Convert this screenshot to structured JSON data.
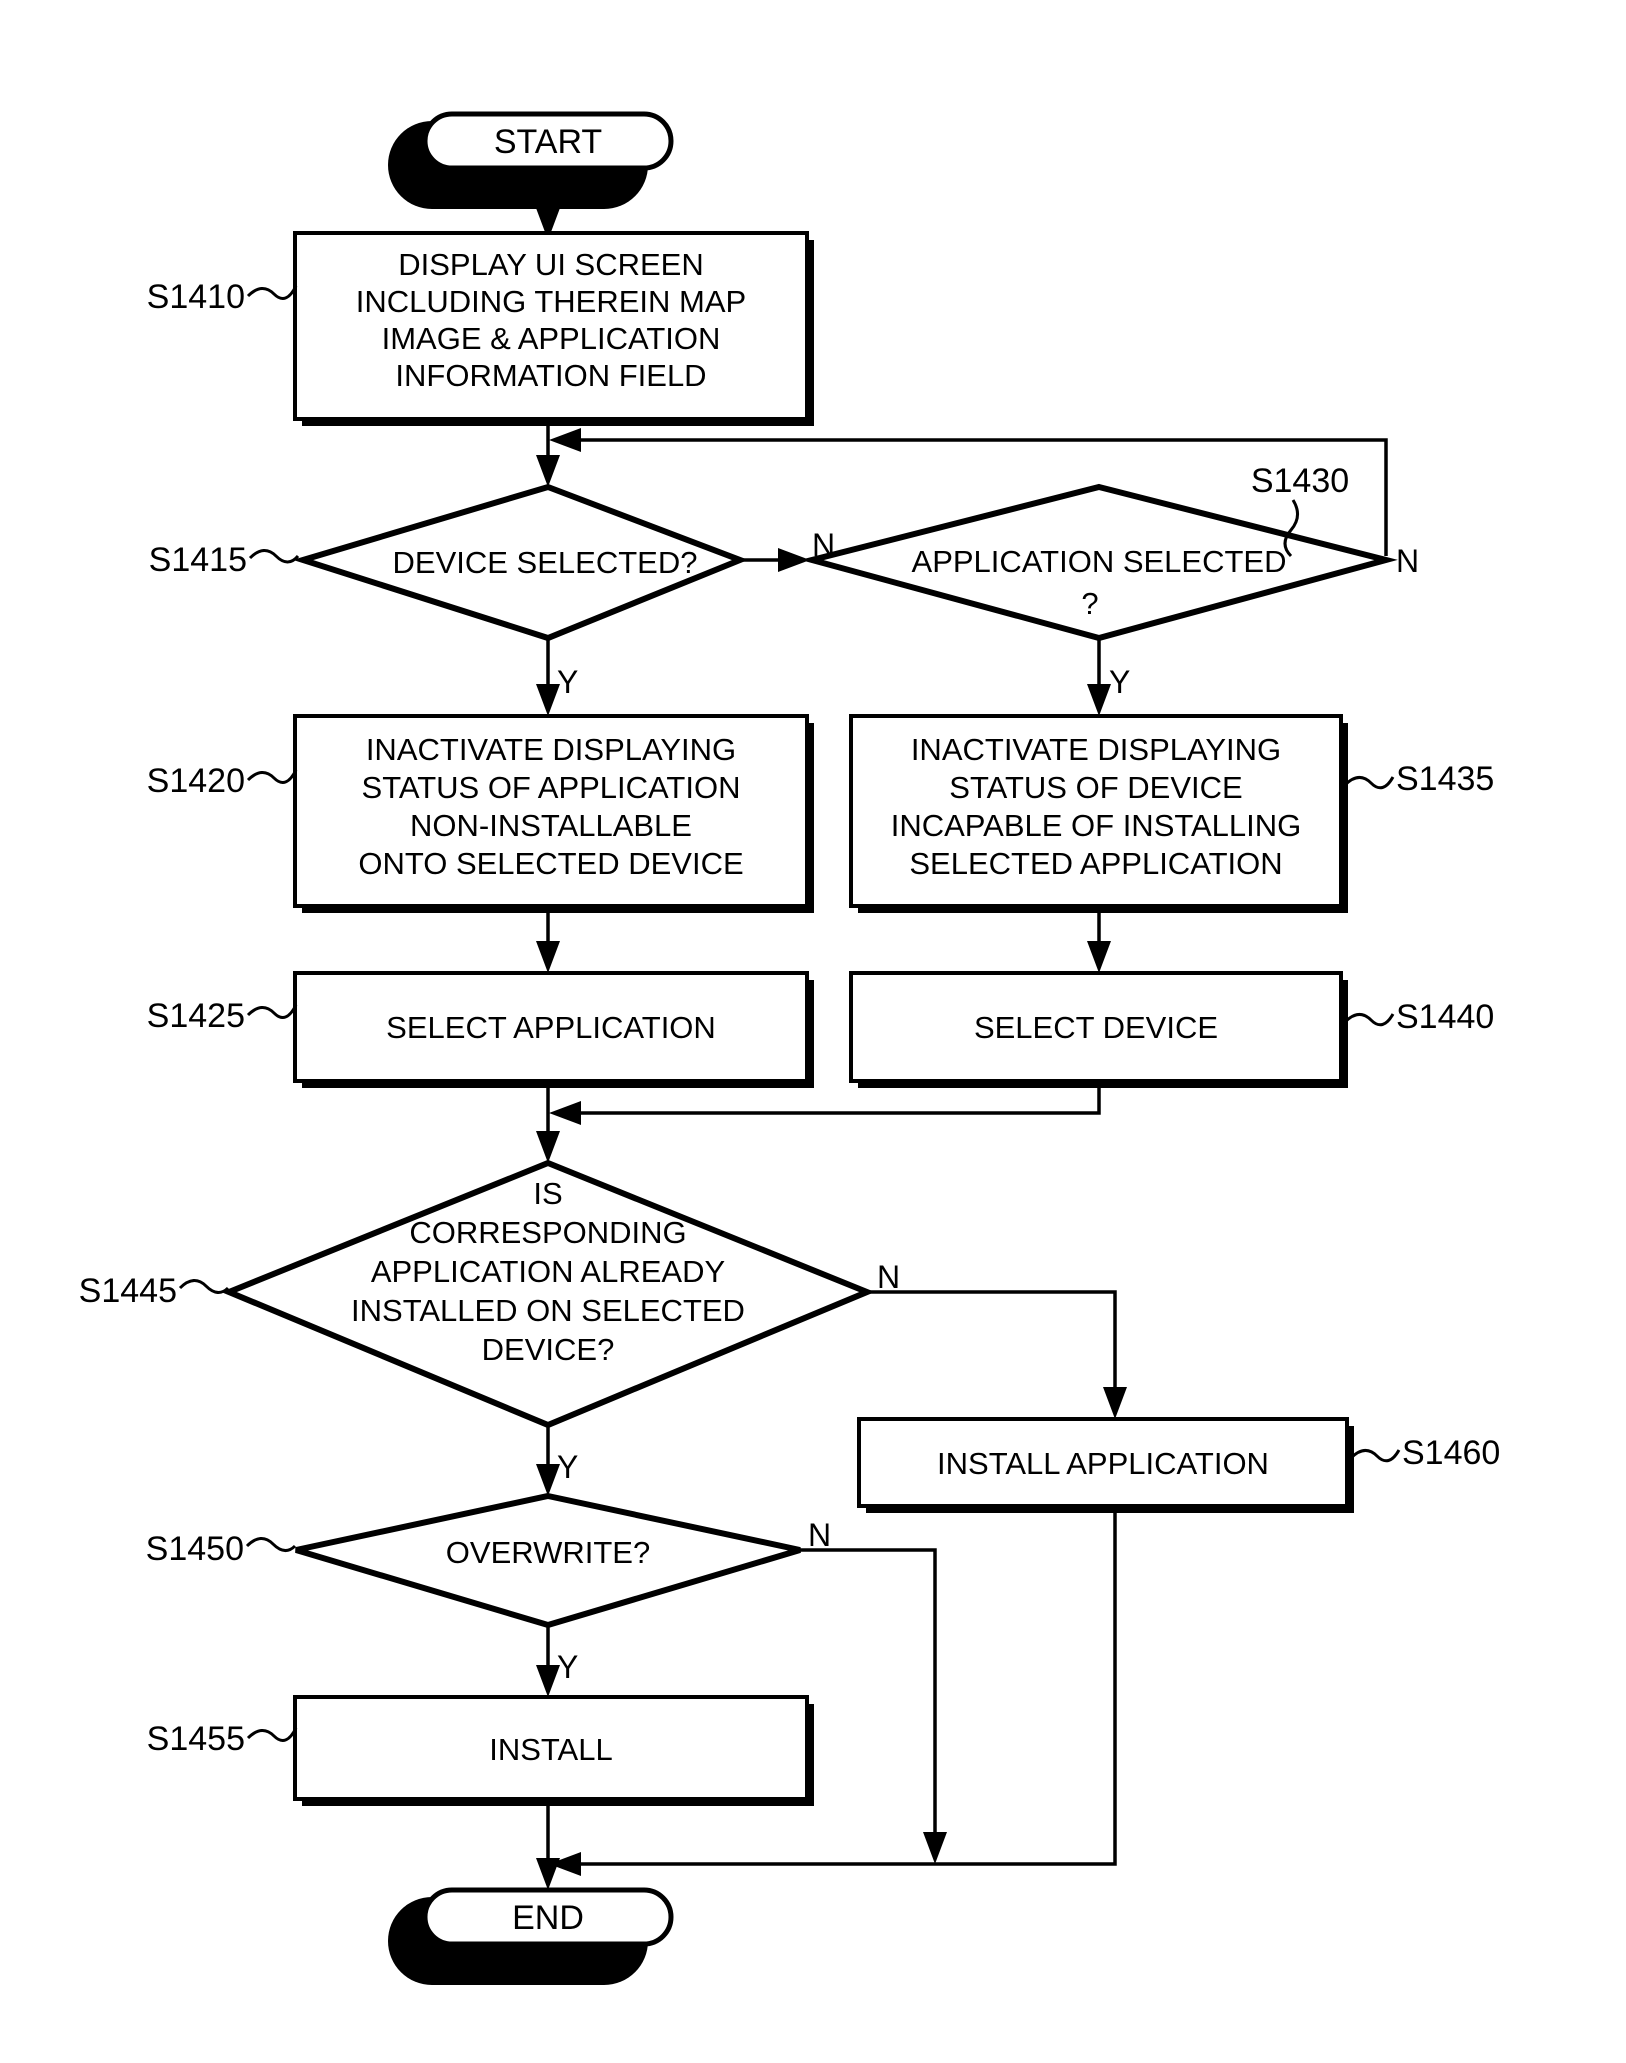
{
  "diagram": {
    "type": "flowchart",
    "title": "",
    "terminals": {
      "start": "START",
      "end": "END"
    },
    "nodes": [
      {
        "id": "S1410",
        "step_label": "S1410",
        "shape": "process",
        "label_side": "left",
        "lines": [
          "DISPLAY UI SCREEN",
          "INCLUDING THEREIN MAP",
          "IMAGE & APPLICATION",
          "INFORMATION FIELD"
        ]
      },
      {
        "id": "S1415",
        "step_label": "S1415",
        "shape": "decision",
        "label_side": "left",
        "lines": [
          "DEVICE SELECTED?"
        ]
      },
      {
        "id": "S1430",
        "step_label": "S1430",
        "shape": "decision",
        "label_side": "top-right",
        "lines": [
          "APPLICATION SELECTED",
          "?"
        ]
      },
      {
        "id": "S1420",
        "step_label": "S1420",
        "shape": "process",
        "label_side": "left",
        "lines": [
          "INACTIVATE DISPLAYING",
          "STATUS OF APPLICATION",
          "NON-INSTALLABLE",
          "ONTO SELECTED DEVICE"
        ]
      },
      {
        "id": "S1435",
        "step_label": "S1435",
        "shape": "process",
        "label_side": "right",
        "lines": [
          "INACTIVATE DISPLAYING",
          "STATUS OF DEVICE",
          "INCAPABLE OF INSTALLING",
          "SELECTED APPLICATION"
        ]
      },
      {
        "id": "S1425",
        "step_label": "S1425",
        "shape": "process",
        "label_side": "left",
        "lines": [
          "SELECT APPLICATION"
        ]
      },
      {
        "id": "S1440",
        "step_label": "S1440",
        "shape": "process",
        "label_side": "right",
        "lines": [
          "SELECT DEVICE"
        ]
      },
      {
        "id": "S1445",
        "step_label": "S1445",
        "shape": "decision",
        "label_side": "left",
        "lines": [
          "IS",
          "CORRESPONDING",
          "APPLICATION ALREADY",
          "INSTALLED ON SELECTED",
          "DEVICE?"
        ]
      },
      {
        "id": "S1460",
        "step_label": "S1460",
        "shape": "process",
        "label_side": "right",
        "lines": [
          "INSTALL APPLICATION"
        ]
      },
      {
        "id": "S1450",
        "step_label": "S1450",
        "shape": "decision",
        "label_side": "left",
        "lines": [
          "OVERWRITE?"
        ]
      },
      {
        "id": "S1455",
        "step_label": "S1455",
        "shape": "process",
        "label_side": "left",
        "lines": [
          "INSTALL"
        ]
      }
    ],
    "branch_labels": {
      "s1415_no": "N",
      "s1415_yes": "Y",
      "s1430_no": "N",
      "s1430_yes": "Y",
      "s1445_no": "N",
      "s1445_yes": "Y",
      "s1450_no": "N",
      "s1450_yes": "Y"
    },
    "colors": {
      "stroke": "#000000",
      "fill": "#ffffff",
      "background": "#ffffff"
    }
  }
}
